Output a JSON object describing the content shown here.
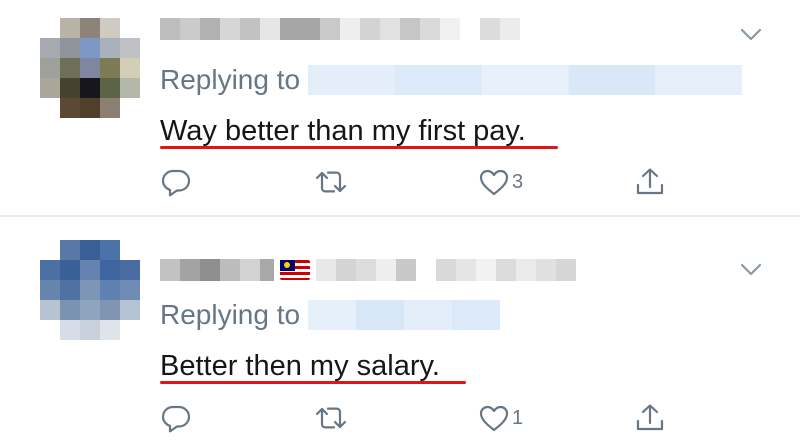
{
  "colors": {
    "text": "#14171a",
    "secondary": "#657786",
    "handle_blur": "#e1eefb",
    "underline": "#e0141b",
    "divider": "#e6ecf0"
  },
  "tweets": [
    {
      "replying_label": "Replying to",
      "text": "Way better than my first pay.",
      "like_count": "3",
      "icons": [
        "chevron-down-icon",
        "reply-icon",
        "retweet-icon",
        "heart-icon",
        "share-icon"
      ]
    },
    {
      "replying_label": "Replying to",
      "text": "Better then my salary.",
      "like_count": "1",
      "icons": [
        "malaysia-flag-icon",
        "chevron-down-icon",
        "reply-icon",
        "retweet-icon",
        "heart-icon",
        "share-icon"
      ]
    }
  ]
}
